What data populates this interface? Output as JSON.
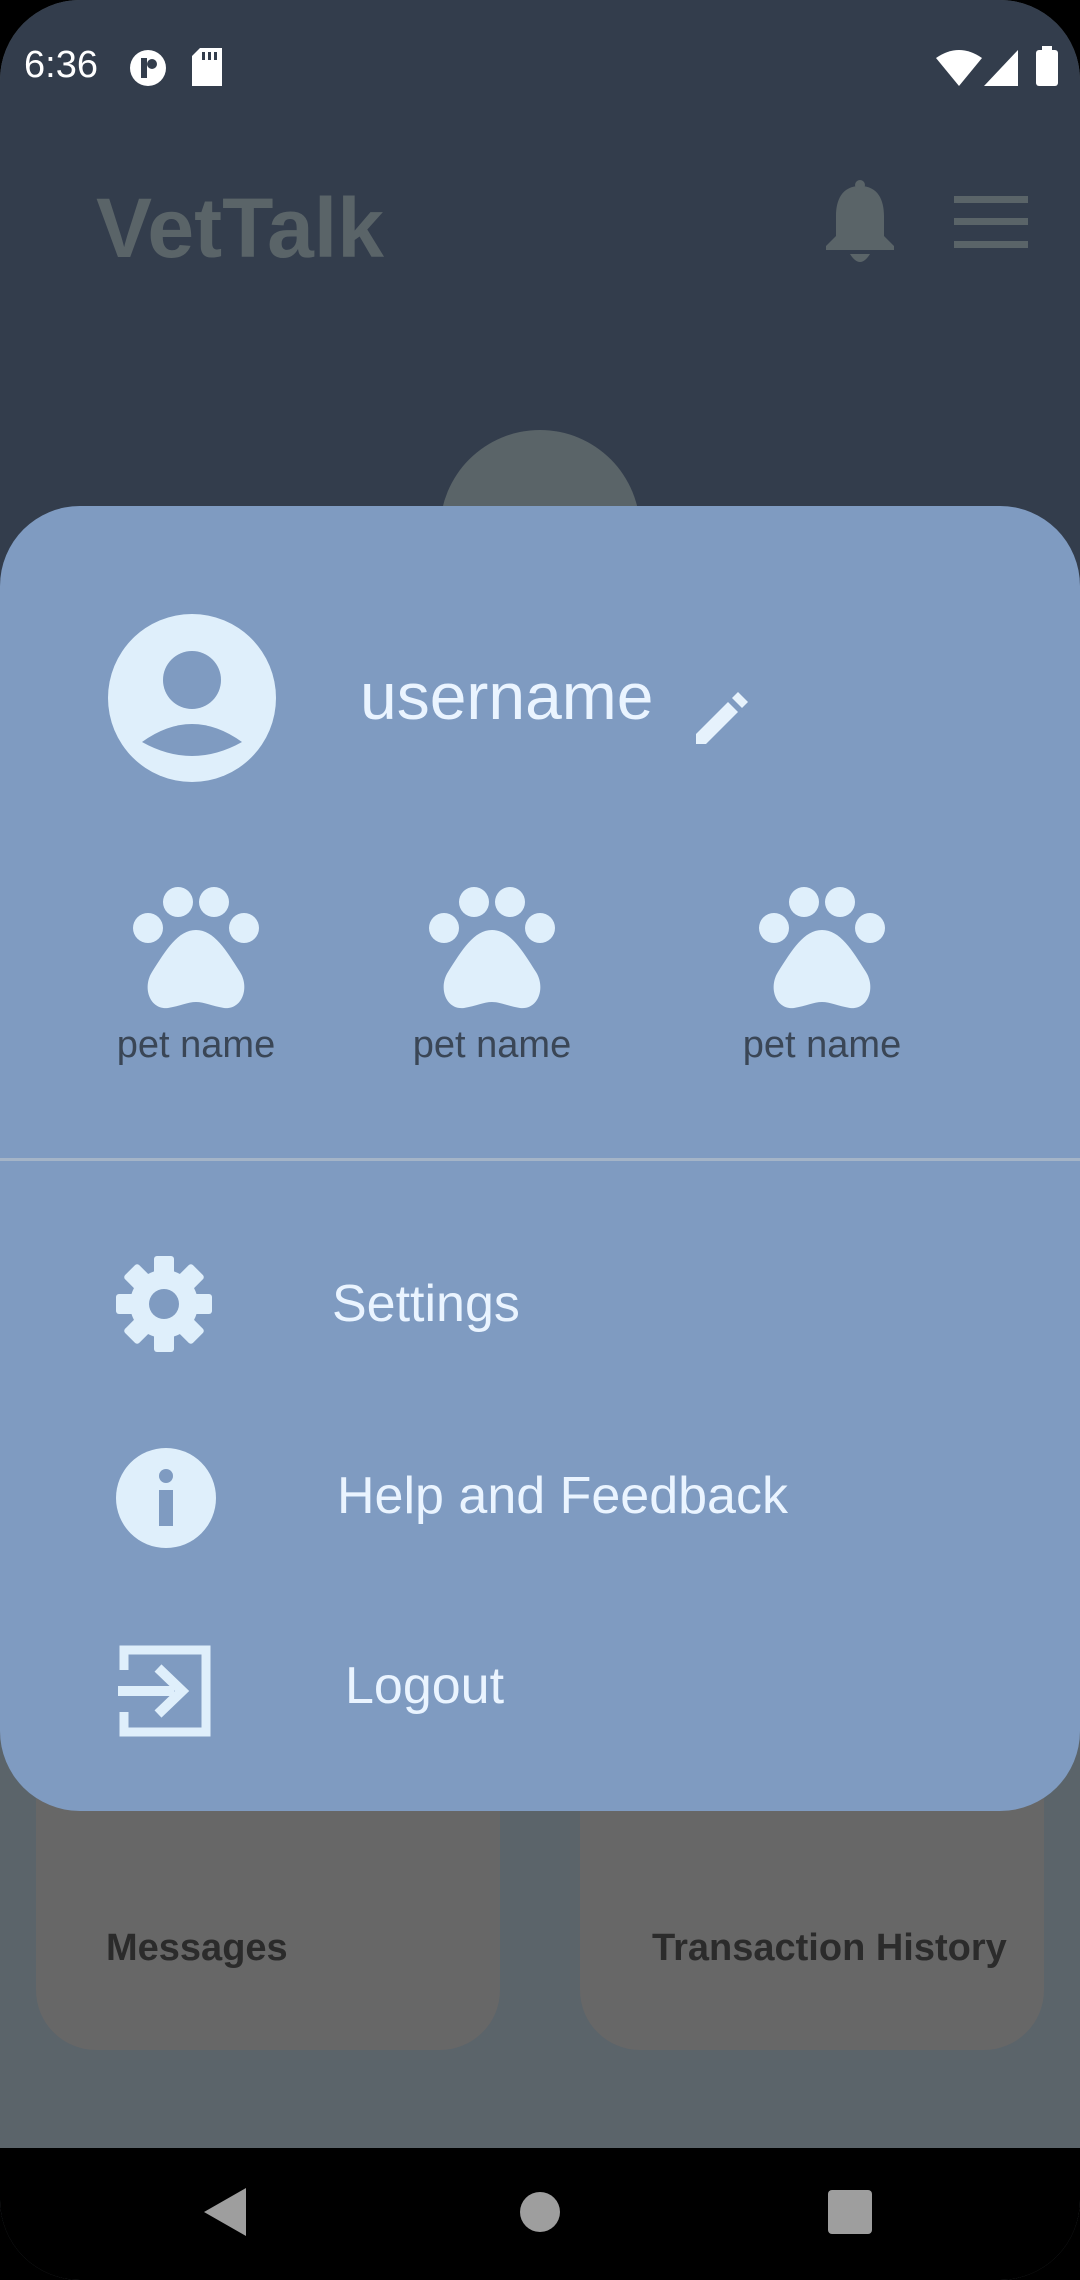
{
  "status_bar": {
    "time": "6:36",
    "icons": [
      "notification-app-icon",
      "sd-card-icon",
      "wifi-icon",
      "cellular-signal-icon",
      "battery-icon"
    ]
  },
  "app": {
    "title": "VetTalk",
    "header_icons": [
      "bell-icon",
      "hamburger-menu-icon"
    ],
    "cards": [
      {
        "label": "Messages"
      },
      {
        "label": "Transaction History"
      }
    ]
  },
  "drawer": {
    "username": "username",
    "pets": [
      {
        "name": "pet name",
        "icon": "paw-icon"
      },
      {
        "name": "pet name",
        "icon": "paw-icon"
      },
      {
        "name": "pet name",
        "icon": "paw-icon"
      }
    ],
    "menu": [
      {
        "label": "Settings",
        "icon": "gear-icon"
      },
      {
        "label": "Help and Feedback",
        "icon": "info-icon"
      },
      {
        "label": "Logout",
        "icon": "logout-icon"
      }
    ]
  },
  "nav_bar": {
    "buttons": [
      "back-icon",
      "home-icon",
      "recents-icon"
    ]
  },
  "colors": {
    "drawer_bg": "#7f9bc1",
    "app_bg_dark": "#333d4c",
    "light_text": "#eaf4ff",
    "pet_label": "#3a4656"
  }
}
